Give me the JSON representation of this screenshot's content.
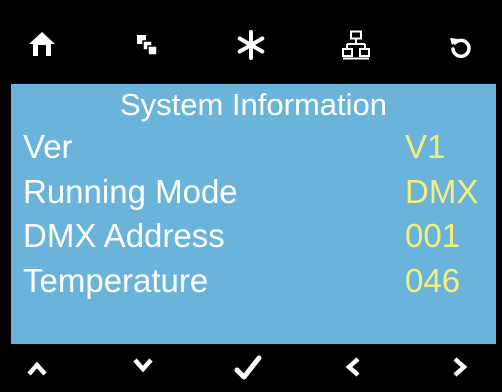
{
  "toolbar": {
    "icons": [
      "home-icon",
      "layers-icon",
      "asterisk-icon",
      "network-icon",
      "refresh-icon"
    ]
  },
  "panel": {
    "title": "System Information",
    "rows": [
      {
        "label": "Ver",
        "value": "V1"
      },
      {
        "label": "Running Mode",
        "value": "DMX"
      },
      {
        "label": "DMX Address",
        "value": "001"
      },
      {
        "label": "Temperature",
        "value": "046"
      }
    ]
  },
  "navbar": {
    "icons": [
      "chevron-up-icon",
      "chevron-down-icon",
      "checkmark-icon",
      "chevron-left-icon",
      "chevron-right-icon"
    ]
  },
  "colors": {
    "panel_background": "#6ab4dc",
    "label_text": "#ffffff",
    "value_text": "#f3f07a",
    "bar_background": "#000000",
    "icon": "#ffffff"
  }
}
